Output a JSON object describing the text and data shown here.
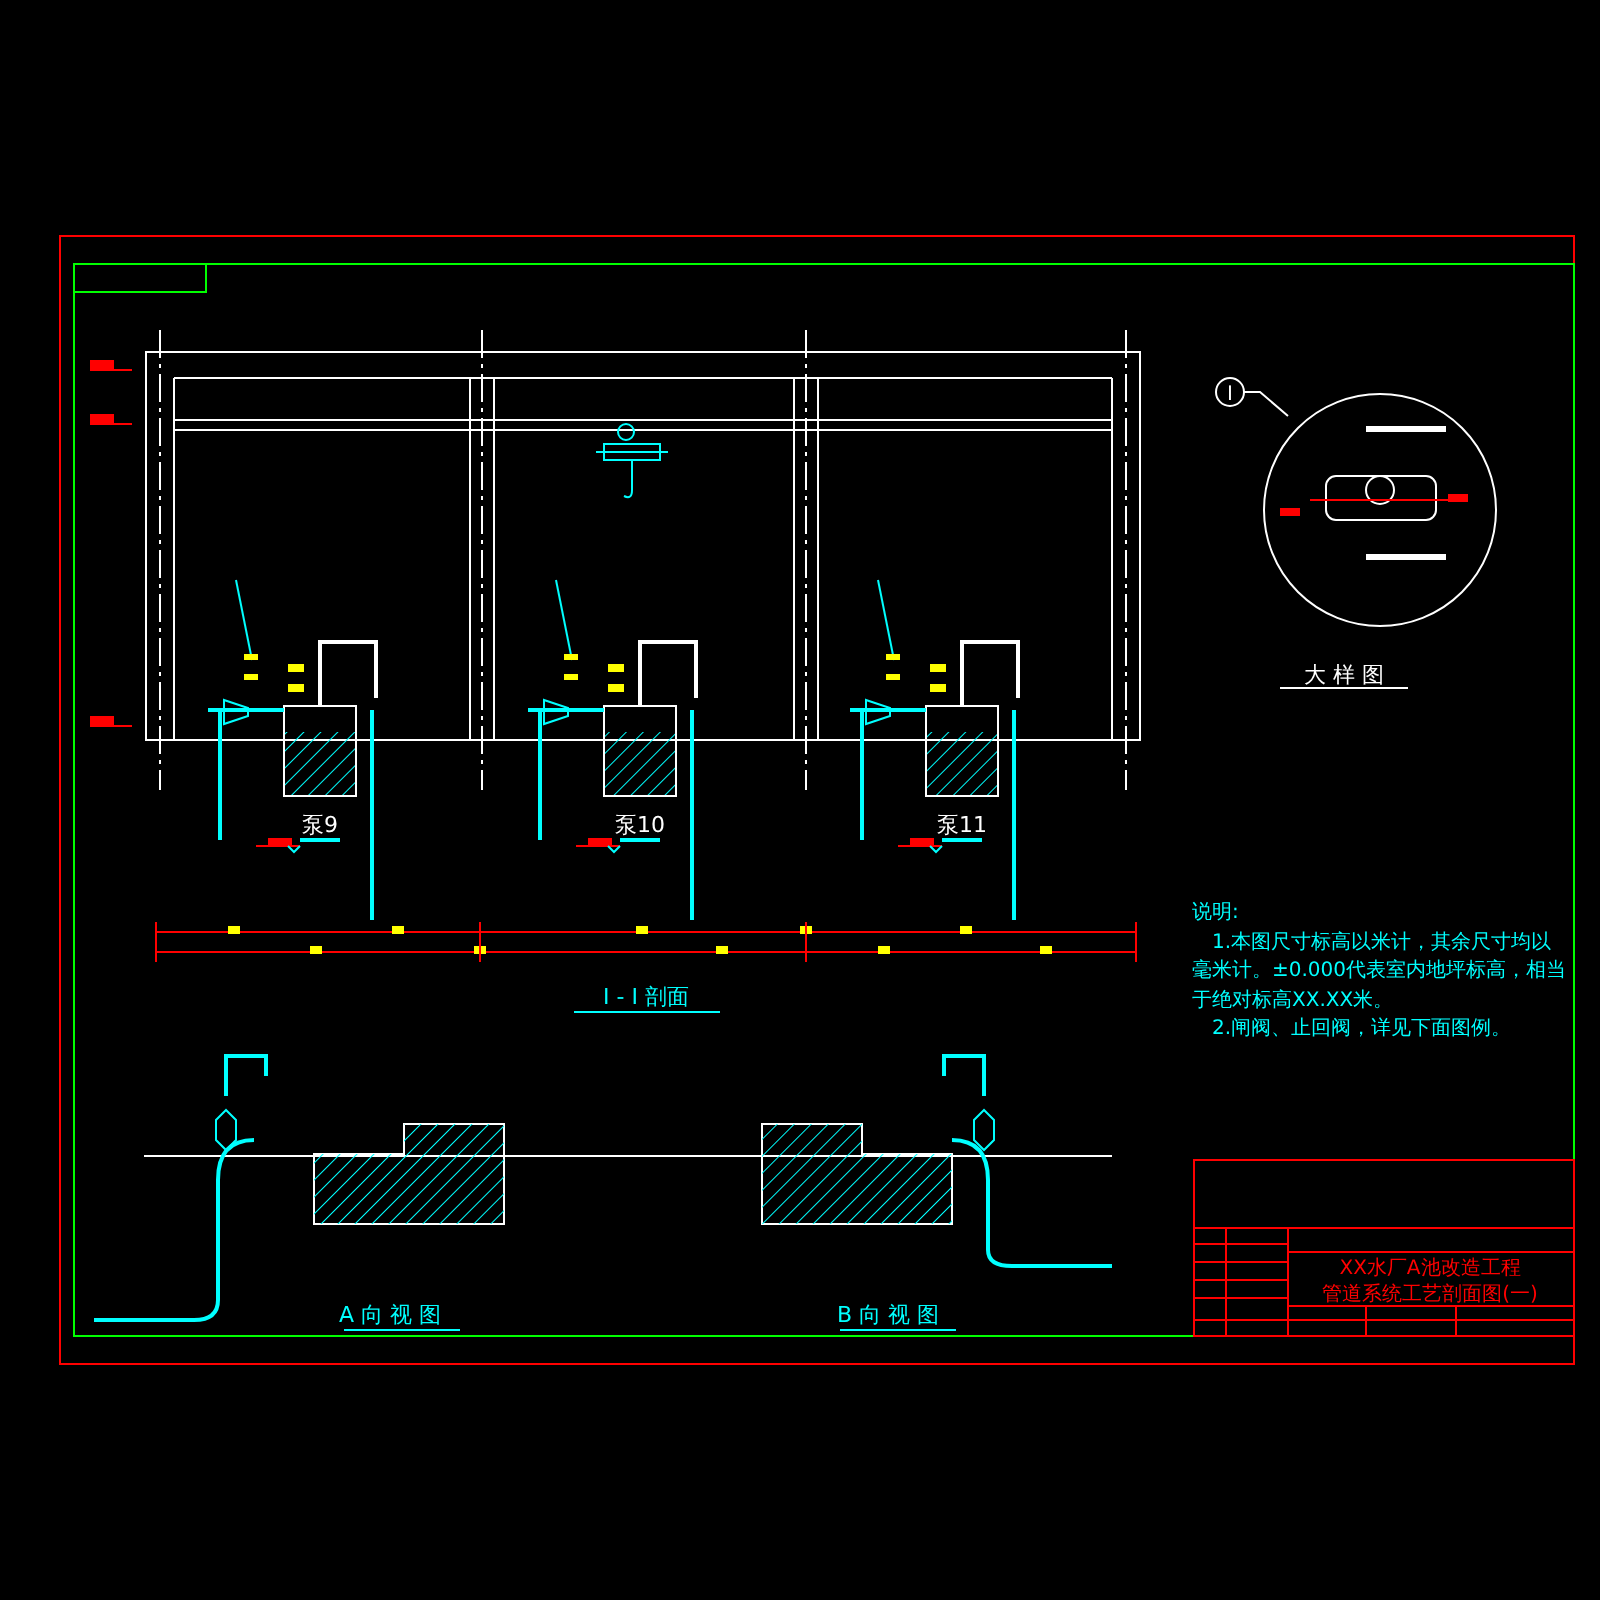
{
  "section_title": "I - I 剖面",
  "pump_labels": [
    "泵9",
    "泵10",
    "泵11"
  ],
  "detail": {
    "marker": "I",
    "title": "大 样 图"
  },
  "notes": {
    "heading": "说明:",
    "items": [
      "1.本图尺寸标高以米计，其余尺寸均以毫米计。±0.000代表室内地坪标高，相当于绝对标高XX.XX米。",
      "2.闸阀、止回阀，详见下面图例。"
    ]
  },
  "views": [
    {
      "label": "A 向 视 图"
    },
    {
      "label": "B 向 视 图"
    }
  ],
  "title_block": {
    "project": "XX水厂A池改造工程",
    "drawing": "管道系统工艺剖面图(一)"
  }
}
